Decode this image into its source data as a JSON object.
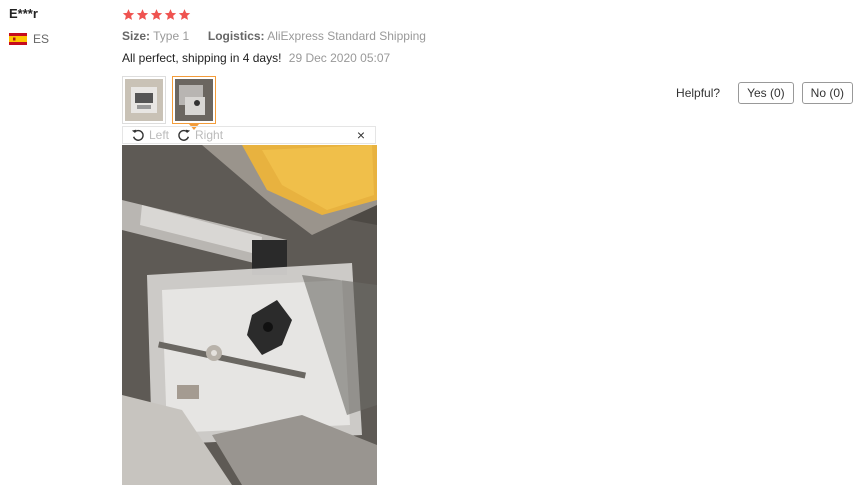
{
  "reviewer": {
    "name": "E***r",
    "country_code": "ES",
    "flag_icon": "spain-flag-icon"
  },
  "review": {
    "rating": 5,
    "size_label": "Size:",
    "size_value": "Type 1",
    "logistics_label": "Logistics:",
    "logistics_value": "AliExpress Standard Shipping",
    "text": "All perfect, shipping in 4 days!",
    "date": "29 Dec 2020 05:07"
  },
  "viewer": {
    "rotate_left": "Left",
    "rotate_right": "Right",
    "close": "×"
  },
  "helpful": {
    "label": "Helpful?",
    "yes": "Yes (0)",
    "no": "No (0)"
  },
  "colors": {
    "star": "#ef5350",
    "accent_orange": "#f39c3a"
  }
}
